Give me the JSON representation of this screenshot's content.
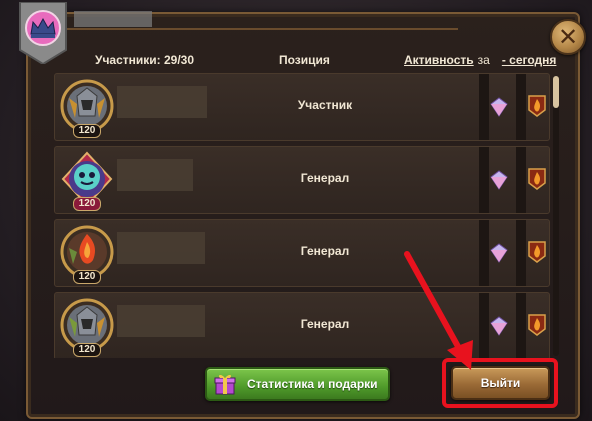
{
  "window": {
    "guild_name_hidden": ""
  },
  "header": {
    "members_label": "Участники: 29/30",
    "position_label": "Позиция",
    "activity_label": "Активность",
    "activity_for": "за",
    "period_label": "- сегодня"
  },
  "members": [
    {
      "level": "120",
      "rank": "Участник",
      "avatar_icon": "armored-knight-avatar"
    },
    {
      "level": "120",
      "rank": "Генерал",
      "avatar_icon": "purple-demon-avatar"
    },
    {
      "level": "120",
      "rank": "Генерал",
      "avatar_icon": "flame-warrior-avatar"
    },
    {
      "level": "120",
      "rank": "Генерал",
      "avatar_icon": "armored-knight-avatar"
    }
  ],
  "buttons": {
    "stats_label": "Статистика и подарки",
    "exit_label": "Выйти",
    "close_icon": "close-icon"
  },
  "colors": {
    "highlight": "#e8121e",
    "green_button": "#4f9a2a",
    "brown_button": "#9a6a36"
  }
}
